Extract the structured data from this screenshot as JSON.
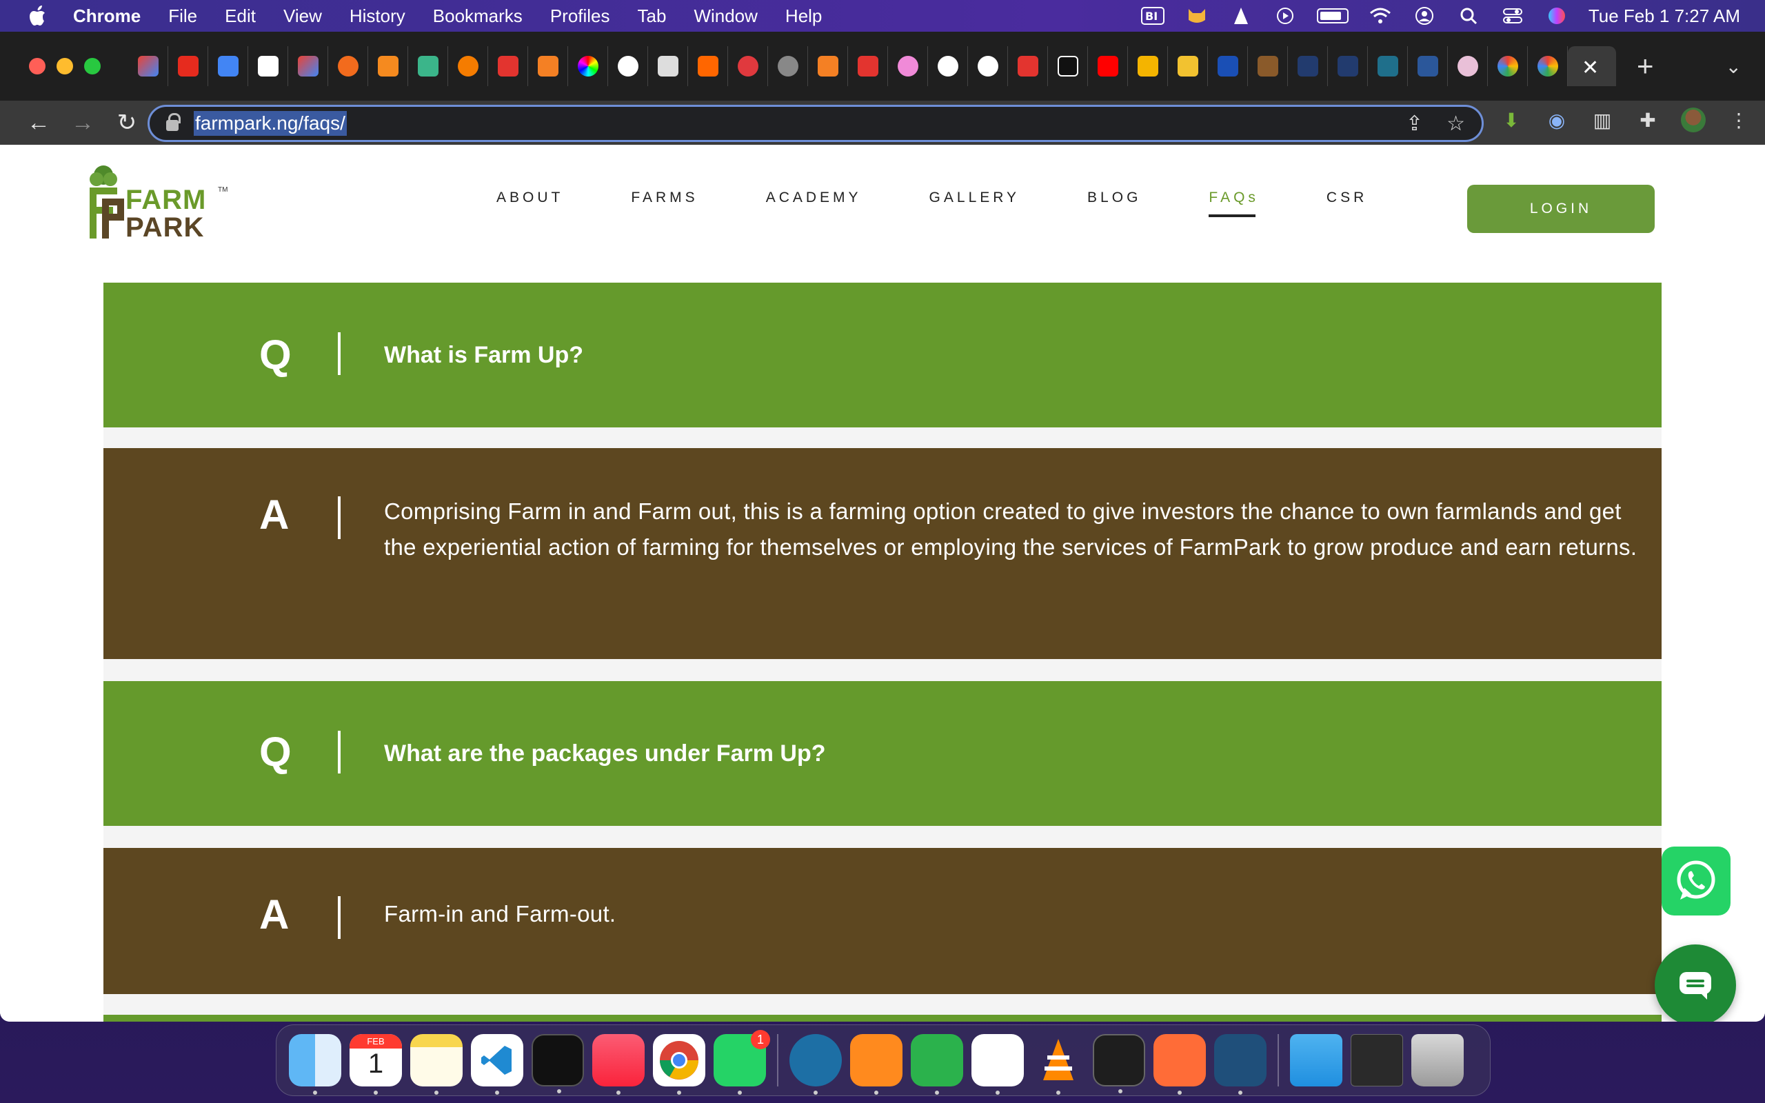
{
  "menubar": {
    "app_name": "Chrome",
    "items": [
      "File",
      "Edit",
      "View",
      "History",
      "Bookmarks",
      "Profiles",
      "Tab",
      "Window",
      "Help"
    ],
    "datetime": "Tue Feb 1  7:27 AM"
  },
  "browser": {
    "url": "farmpark.ng/faqs/",
    "tab_close": "✕",
    "new_tab": "+"
  },
  "site": {
    "logo_top": "FARM",
    "logo_bottom": "PARK",
    "logo_tm": "TM",
    "nav": [
      "ABOUT",
      "FARMS",
      "ACADEMY",
      "GALLERY",
      "BLOG",
      "FAQs",
      "CSR"
    ],
    "active_nav": "FAQs",
    "login_label": "LOGIN"
  },
  "faqs": [
    {
      "q_letter": "Q",
      "question": "What is Farm Up?",
      "a_letter": "A",
      "answer": "Comprising Farm in and Farm out, this is a farming option created to give investors the chance to own farmlands and get the experiential action of farming for themselves or employing the services of FarmPark to grow produce and earn returns."
    },
    {
      "q_letter": "Q",
      "question": "What are the packages under Farm Up?",
      "a_letter": "A",
      "answer": "Farm-in and Farm-out."
    }
  ],
  "dock": {
    "calendar_month": "FEB",
    "calendar_day": "1",
    "whatsapp_badge": "1"
  },
  "colors": {
    "question_bg": "#659a2c",
    "answer_bg": "#5d4720",
    "accent_green": "#6a9a3a",
    "whatsapp": "#25d366"
  }
}
